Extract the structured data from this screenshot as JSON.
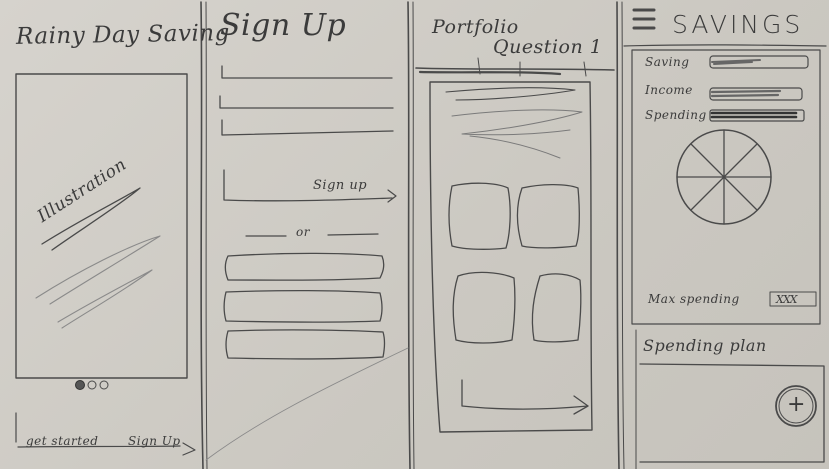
{
  "screens": [
    {
      "title": "Rainy Day Saving",
      "illustration_label": "Illustration",
      "get_started_label": "get started",
      "sign_up_label": "Sign Up"
    },
    {
      "title": "Sign Up",
      "sign_up_link": "Sign up",
      "divider_label": "or"
    },
    {
      "title_line1": "Portfolio",
      "title_line2": "Question 1"
    },
    {
      "title": "SAVINGS",
      "rows": [
        {
          "label": "Saving"
        },
        {
          "label": "Income"
        },
        {
          "label": "Spending"
        }
      ],
      "max_spending_label": "Max spending",
      "max_spending_value": "XXX",
      "plan_title": "Spending plan",
      "add_button_glyph": "+"
    }
  ],
  "colors": {
    "paper": "#cfccc6",
    "pencil": "#3b3b3b"
  }
}
